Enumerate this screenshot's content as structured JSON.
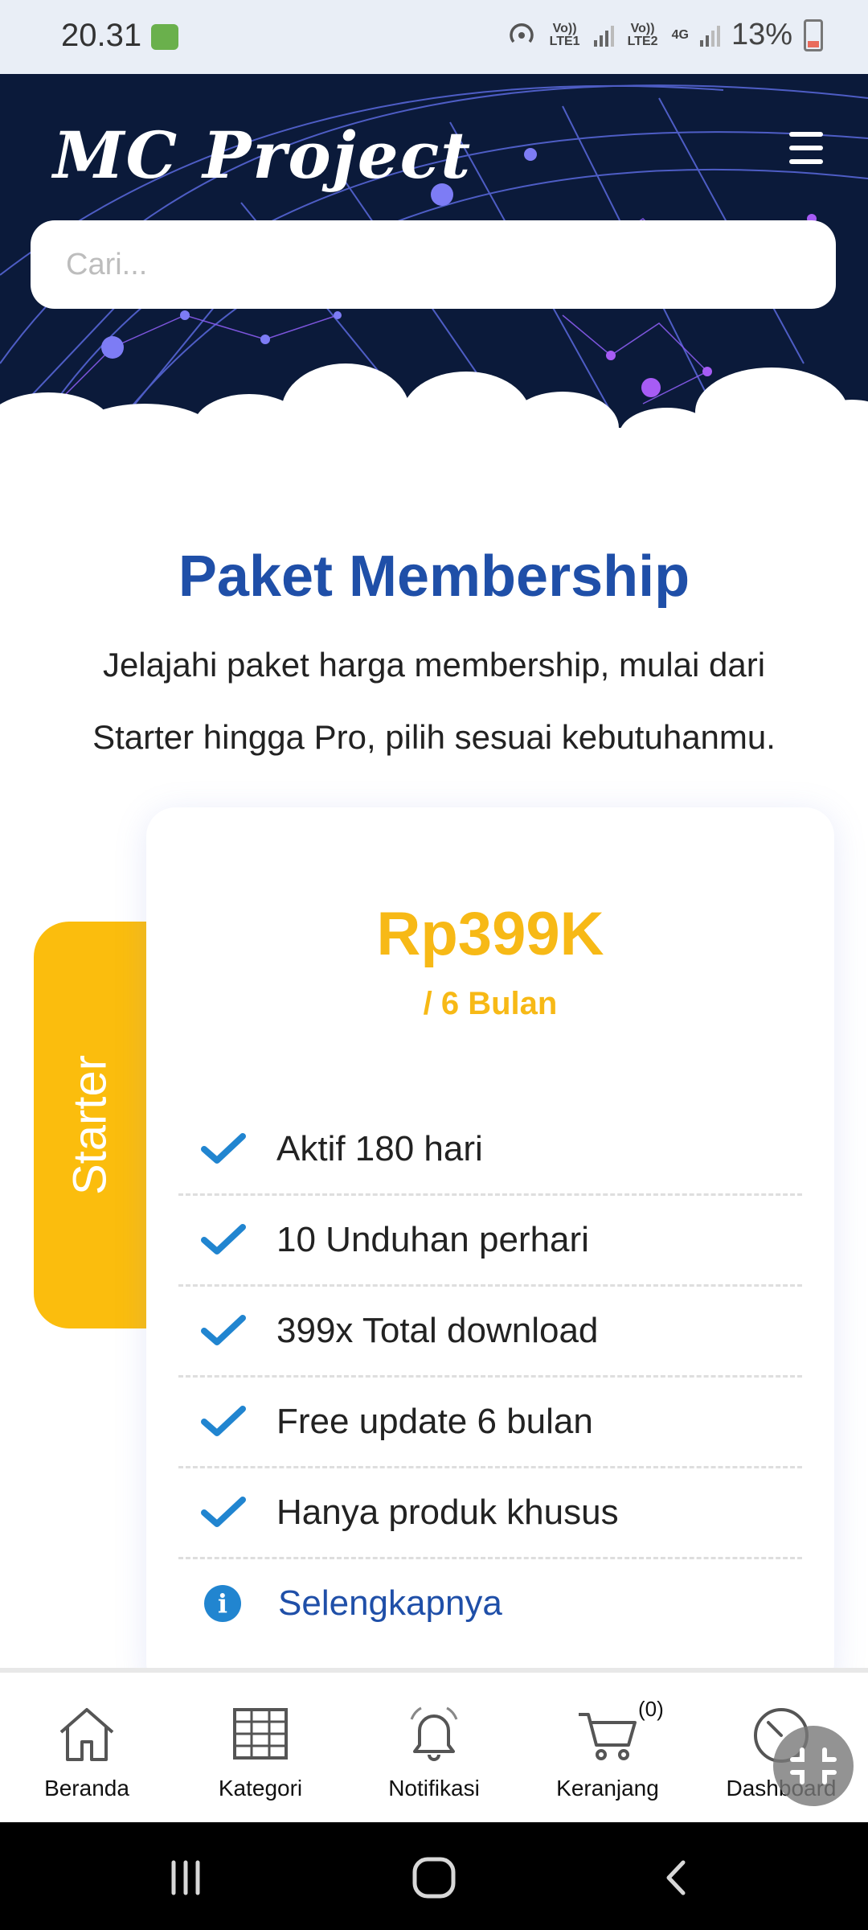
{
  "status_bar": {
    "time": "20.31",
    "battery": "13%",
    "sim1": "Vo)) LTE1",
    "sim2": "Vo)) LTE2",
    "network": "4G"
  },
  "header": {
    "logo": "MC Project",
    "menu_icon": "hamburger-icon"
  },
  "search": {
    "placeholder": "Cari..."
  },
  "section": {
    "title": "Paket Membership",
    "subtitle": "Jelajahi paket harga membership, mulai dari Starter hingga Pro, pilih sesuai kebutuhanmu."
  },
  "plan": {
    "tab_label": "Starter",
    "price": "Rp399K",
    "period": "/ 6 Bulan",
    "features": [
      "Aktif 180 hari",
      "10 Unduhan perhari",
      "399x Total download",
      "Free update 6 bulan",
      "Hanya produk khusus"
    ],
    "more_label": "Selengkapnya",
    "accent_color": "#fbbd0d",
    "check_color": "#2185d0"
  },
  "bottom_nav": {
    "items": [
      {
        "label": "Beranda",
        "icon": "home-icon"
      },
      {
        "label": "Kategori",
        "icon": "grid-icon"
      },
      {
        "label": "Notifikasi",
        "icon": "bell-icon"
      },
      {
        "label": "Keranjang",
        "icon": "cart-icon"
      },
      {
        "label": "Dashboard",
        "icon": "speedometer-icon"
      }
    ],
    "cart_count": "(0)"
  }
}
